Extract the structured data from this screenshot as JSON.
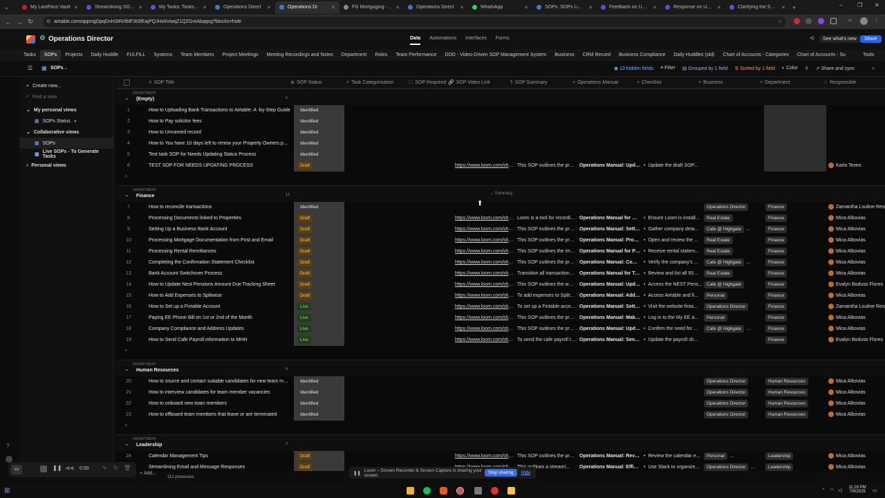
{
  "browser": {
    "tabs": [
      {
        "title": "My LastPass Vault",
        "color": "#cc2222",
        "active": false
      },
      {
        "title": "Streamlining SOP Up",
        "color": "#6a4bd6",
        "active": false
      },
      {
        "title": "My Tasks: Tasks - Airt",
        "color": "#6a4bd6",
        "active": false
      },
      {
        "title": "Operations Direct",
        "color": "#3a7bd5",
        "active": false
      },
      {
        "title": "Operations Di",
        "color": "#3a7bd5",
        "active": true
      },
      {
        "title": "FG Mortgaging - Link",
        "color": "#888888",
        "active": false
      },
      {
        "title": "Operations Direct",
        "color": "#3a7bd5",
        "active": false
      },
      {
        "title": "WhatsApp",
        "color": "#25d366",
        "active": false
      },
      {
        "title": "SOPs: SOPs Library",
        "color": "#3a7bd5",
        "active": false
      },
      {
        "title": "Feedback on Update",
        "color": "#6a4bd6",
        "active": false
      },
      {
        "title": "Response on Update",
        "color": "#6a4bd6",
        "active": false
      },
      {
        "title": "Clarifying the SOP C",
        "color": "#6a4bd6",
        "active": false
      }
    ],
    "url": "airtable.com/appnqjDpqDnH3IRI/tblF3tSfEajPQJHol/viwqZ1QZGntAbqqsg?blocks=hide"
  },
  "app": {
    "base_name": "Operations Director",
    "header_links": [
      "Data",
      "Automations",
      "Interfaces",
      "Forms"
    ],
    "whats_new": "See what's new",
    "share": "Share",
    "tables": [
      "Tasks",
      "SOPs",
      "Projects",
      "Daily Huddle",
      "FULFILL",
      "Systems",
      "Team Members",
      "Project Meetings",
      "Meeting Recordings and Notes",
      "Department",
      "Roles",
      "Team Performance",
      "DOD - Video-Driven SOP Management System",
      "Business",
      "CRM Record",
      "Business Compliance",
      "Daily Huddles (old)",
      "Chart of Accounts - Categories",
      "Chart of Accounts - Su"
    ],
    "tools": "Tools",
    "view_name": "SOPs",
    "toolbar": {
      "hidden": "13 hidden fields",
      "filter": "Filter",
      "grouped": "Grouped by 1 field",
      "sorted": "Sorted by 1 field",
      "color": "Color",
      "share_sync": "Share and sync"
    }
  },
  "sidebar": {
    "create_new": "Create new...",
    "find_placeholder": "Find a view",
    "my_views_title": "My personal views",
    "my_views": [
      "SOPs Status"
    ],
    "collab_title": "Collaborative views",
    "collab_views": [
      "SOPs",
      "Live SOPs - To Generate Tasks"
    ],
    "personal_title": "Personal views"
  },
  "columns": [
    "SOP Title",
    "SOP Status",
    "Task Categorisation",
    "SOP Required",
    "SOP Video Link",
    "SOP Summary",
    "Operations Manual",
    "Checklist",
    "Business",
    "Department",
    "Responsible"
  ],
  "group_label": "DEPARTMENT",
  "groups": [
    {
      "name": "(Empty)",
      "count": "6",
      "rows": [
        {
          "n": "1",
          "title": "How to Uploading Bank Transactions to Airtable: A -by-Step Guide",
          "status": "Identified"
        },
        {
          "n": "2",
          "title": "How to Pay solicitor fees",
          "status": "Identified"
        },
        {
          "n": "3",
          "title": "How to Unnamed record",
          "status": "Identified"
        },
        {
          "n": "4",
          "title": "How to You have 10 days left to renew your Property Owners policy",
          "status": "Identified"
        },
        {
          "n": "5",
          "title": "Test task SOP for Needs Updating Status Process",
          "status": "Identified"
        },
        {
          "n": "6",
          "title": "TEST SOP FOR NEEDS UPDATING PROCESS",
          "status": "Draft",
          "link": "https://www.loom.com/sha...",
          "summary": "This SOP outlines the proc...",
          "manual": "Operations Manual: Updat...",
          "checklist": "Update the draft SOP...",
          "resp": "Karlo Teves"
        }
      ]
    },
    {
      "name": "Finance",
      "count": "13",
      "rows": [
        {
          "n": "7",
          "title": "How to reconcile transactions",
          "status": "Identified",
          "business": [
            "Operations Director"
          ],
          "dept": "Finance",
          "resp": "Zamantha Louline Respi"
        },
        {
          "n": "8",
          "title": "Processing Documents linked to Properties",
          "status": "Draft",
          "link": "https://www.loom.com/sha...",
          "summary": "Loom is a tool for recordin...",
          "manual": "Operations Manual for Re...",
          "checklist": "Ensure Loom is install...",
          "business": [
            "Real Estate"
          ],
          "dept": "Finance",
          "resp": "Mica Albovias"
        },
        {
          "n": "9",
          "title": "Setting Up a Business Bank Account",
          "status": "Draft",
          "link": "https://www.loom.com/sha...",
          "summary": "This SOP outlines the proc...",
          "manual": "Operations Manual: Settin...",
          "checklist": "Gather company deta...",
          "business": [
            "Cafe @ Highgate",
            "Operatior"
          ],
          "dept": "Finance",
          "resp": "Mica Albovias"
        },
        {
          "n": "10",
          "title": "Processing Mortgage Documentation from Post and Email",
          "status": "Draft",
          "link": "https://www.loom.com/sha...",
          "summary": "This SOP outlines the proc...",
          "manual": "Operations Manual: Proce...",
          "checklist": "Open and review the ...",
          "business": [
            "Real Estate"
          ],
          "dept": "Finance",
          "resp": "Mica Albovias"
        },
        {
          "n": "11",
          "title": "Processing Rental Remittances",
          "status": "Draft",
          "link": "https://www.loom.com/sha...",
          "summary": "This SOP outlines the imme...",
          "manual": "Operations Manual for Pr...",
          "checklist": "Receive rental statem...",
          "business": [
            "Real Estate"
          ],
          "dept": "Finance",
          "resp": "Mica Albovias"
        },
        {
          "n": "12",
          "title": "Completing the Confirmation Statement Checklist",
          "status": "Draft",
          "link": "https://www.loom.com/sha...",
          "summary": "This SOP outlines the proc...",
          "manual": "Operations Manual: Comp...",
          "checklist": "Verify the company's ...",
          "business": [
            "Cafe @ Highgate",
            "Operatior"
          ],
          "dept": "Finance",
          "resp": "Mica Albovias"
        },
        {
          "n": "13",
          "title": "Bank Account Switchover Process",
          "status": "Draft",
          "link": "https://www.loom.com/sha...",
          "summary": "Transition all transactions fr...",
          "manual": "Operations Manual for Tra...",
          "checklist": "Review and list all 93 ...",
          "business": [
            "Real Estate"
          ],
          "dept": "Finance",
          "resp": "Mica Albovias"
        },
        {
          "n": "14",
          "title": "How to Update Nest Pensions Amount Due Tracking Sheet",
          "status": "Draft",
          "link": "https://www.loom.com/sha...",
          "summary": "This SOP outlines the week...",
          "manual": "Operations Manual: Updat...",
          "checklist": "Access the NEST Pens...",
          "business": [
            "Cafe @ Highgate"
          ],
          "dept": "Finance",
          "resp": "Evalyn Boduso Flores"
        },
        {
          "n": "15",
          "title": "How to Add Expenses to Splitwise",
          "status": "Draft",
          "link": "https://www.loom.com/sha...",
          "summary": "To add expenses to Splitwis...",
          "manual": "Operations Manual: Addin...",
          "checklist": "Access Airtable and fi...",
          "business": [
            "Personal"
          ],
          "dept": "Finance",
          "resp": "Mica Albovias"
        },
        {
          "n": "16",
          "title": "How to Set up a Fintable Account",
          "status": "Live",
          "link": "https://www.loom.com/sha...",
          "summary": "To set up a Fintable accoun...",
          "manual": "Operations Manual: Settin...",
          "checklist": "Visit the website finta...",
          "business": [
            "Operations Director"
          ],
          "dept": "Finance",
          "resp": "Zamantha Louline Respi"
        },
        {
          "n": "17",
          "title": "Paying EE Phone Bill on 1st or 2nd of the Month",
          "status": "Live",
          "link": "https://www.loom.com/sha...",
          "summary": "This SOP outlines the proc...",
          "manual": "Operations Manual: Makin...",
          "checklist": "Log in to the My EE a...",
          "business": [
            "Personal"
          ],
          "dept": "Finance",
          "resp": "Mica Albovias"
        },
        {
          "n": "18",
          "title": "Company Compliance and Address Updates",
          "status": "Live",
          "link": "https://www.loom.com/sha...",
          "summary": "This SOP outlines the proc...",
          "manual": "Operations Manual: Updat...",
          "checklist": "Confirm the need for ...",
          "business": [
            "Cafe @ Highgate",
            "Operatior"
          ],
          "dept": "Finance",
          "resp": "Mica Albovias"
        },
        {
          "n": "19",
          "title": "How to Send Cafe Payroll information to MHH",
          "status": "Live",
          "link": "https://www.loom.com/sha...",
          "summary": "To send the cafe payroll to ...",
          "manual": "Operations Manual: Sendi...",
          "checklist": "Update the payroll sh...",
          "dept": "Finance",
          "resp": "Evalyn Boduso Flores"
        }
      ]
    },
    {
      "name": "Human Resources",
      "count": "4",
      "rows": [
        {
          "n": "20",
          "title": "How to source and contact suitable candidates for new team member ...",
          "status": "Identified",
          "business": [
            "Operations Director"
          ],
          "dept": "Human Resources",
          "resp": "Mica Albovias"
        },
        {
          "n": "21",
          "title": "How to interview candidates for team member vacancies",
          "status": "Identified",
          "business": [
            "Operations Director"
          ],
          "dept": "Human Resources",
          "resp": "Mica Albovias"
        },
        {
          "n": "22",
          "title": "How to onboard new team members",
          "status": "Identified",
          "business": [
            "Operations Director"
          ],
          "dept": "Human Resources",
          "resp": "Mica Albovias"
        },
        {
          "n": "23",
          "title": "How to offboard team members that leave or are terminated",
          "status": "Identified",
          "business": [
            "Operations Director"
          ],
          "dept": "Human Resources",
          "resp": "Mica Albovias"
        }
      ]
    },
    {
      "name": "Leadership",
      "count": "3",
      "rows": [
        {
          "n": "24",
          "title": "Calendar Management Tips",
          "status": "Draft",
          "link": "https://www.loom.com/sha...",
          "summary": "This SOP outlines the proc...",
          "manual": "Operations Manual: Revie...",
          "checklist": "Review the calendar e...",
          "business": [
            "Personal",
            "Operations Directo"
          ],
          "dept": "Leadership",
          "resp": "Mica Albovias"
        },
        {
          "n": "25",
          "title": "Streamlining Email and Message Responses",
          "status": "Draft",
          "link": "https://www.loom.com/sha...",
          "summary": "This outlines a streaml...",
          "manual": "Operations Manual: Efficie...",
          "checklist": "Use Slack to organize...",
          "business": [
            "Operations Director",
            "Person"
          ],
          "dept": "Leadership",
          "resp": "Mica Albovias"
        }
      ]
    }
  ],
  "hover_summary": "Summary",
  "add_label": "Add...",
  "records_label": "112 processes",
  "loom": {
    "text": "Loom – Screen Recorder & Screen Capture is sharing your screen.",
    "stop": "Stop sharing",
    "hide": "Hide"
  },
  "recorder_time": "0:00",
  "clock": {
    "time": "11:28 PM",
    "date": "7/9/2025"
  }
}
